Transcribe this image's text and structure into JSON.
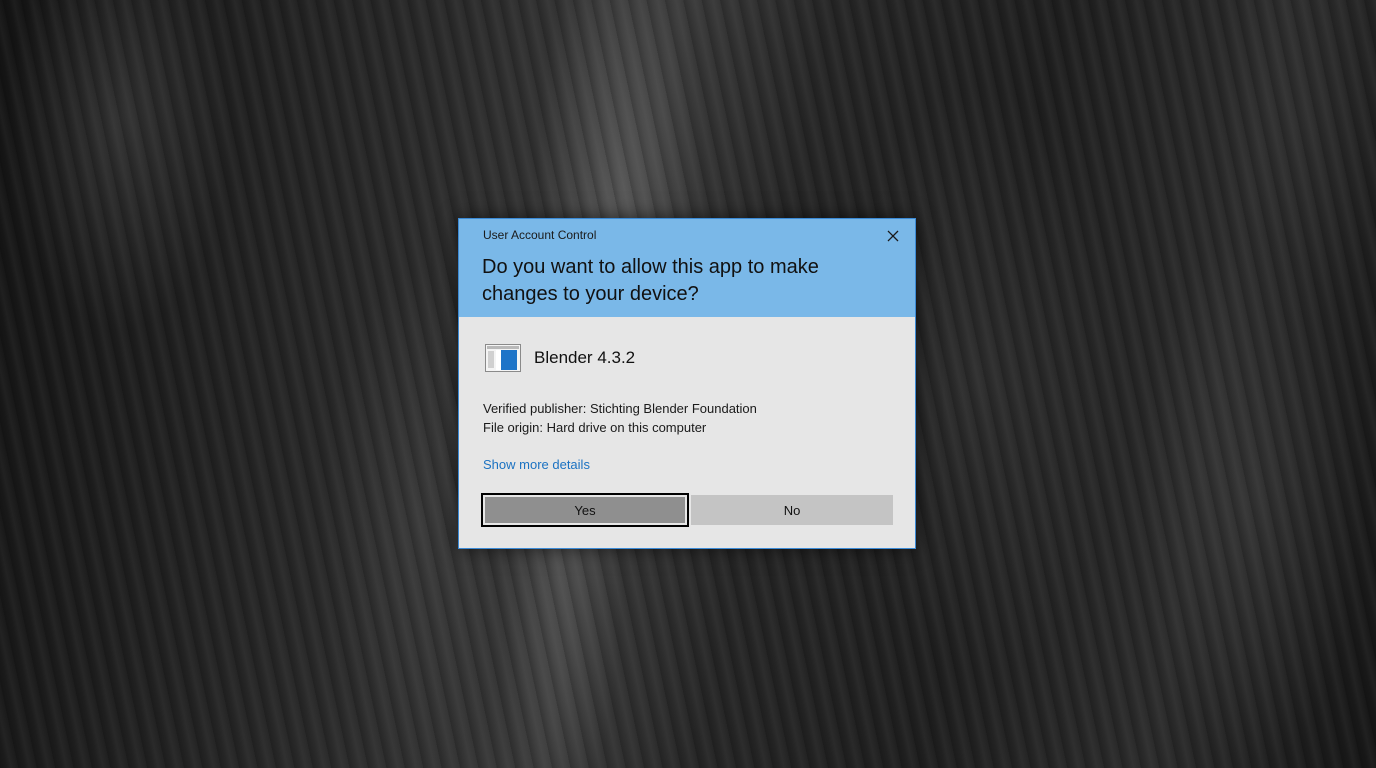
{
  "dialog": {
    "caption": "User Account Control",
    "question": "Do you want to allow this app to make changes to your device?",
    "app_name": "Blender 4.3.2",
    "publisher_line": "Verified publisher: Stichting Blender Foundation",
    "origin_line": "File origin: Hard drive on this computer",
    "details_link": "Show more details",
    "yes_label": "Yes",
    "no_label": "No"
  },
  "colors": {
    "header": "#7ab8e8",
    "body": "#e6e6e6",
    "link": "#1b72c2",
    "yes_button": "#8f8f8f",
    "no_button": "#c4c4c4"
  },
  "icons": {
    "close": "close-icon",
    "app": "app-window-icon"
  }
}
